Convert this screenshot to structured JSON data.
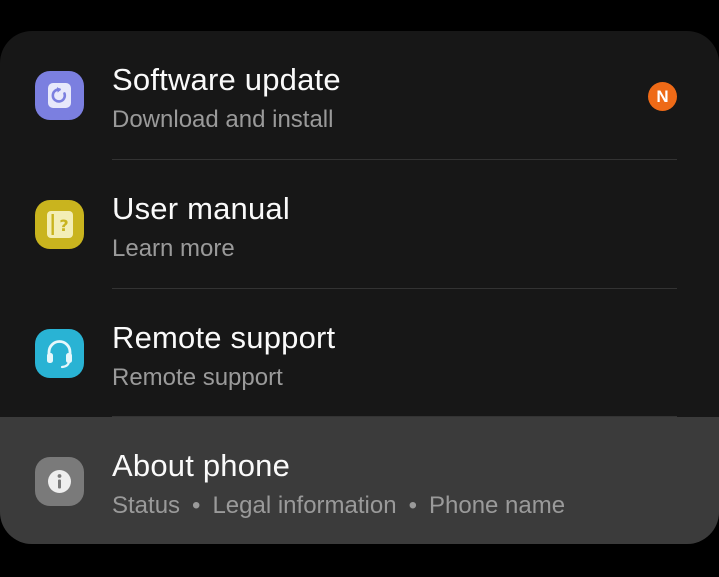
{
  "colors": {
    "card_background": "#171717",
    "selected_row_background": "#3b3b3b",
    "title_text": "#fafafa",
    "subtitle_text": "#9a9a9a",
    "software_update_icon": "#7b7fe0",
    "user_manual_icon": "#c9b41e",
    "remote_support_icon": "#29b3d4",
    "about_phone_icon": "#7a7a7a",
    "badge": "#ee6a17"
  },
  "items": [
    {
      "title": "Software update",
      "subtitle": "Download and install",
      "icon": "software-update-icon",
      "badge": "N"
    },
    {
      "title": "User manual",
      "subtitle": "Learn more",
      "icon": "user-manual-icon"
    },
    {
      "title": "Remote support",
      "subtitle": "Remote support",
      "icon": "headset-icon"
    },
    {
      "title": "About phone",
      "subtitle_parts": [
        "Status",
        "Legal information",
        "Phone name"
      ],
      "separator": "•",
      "icon": "info-icon",
      "selected": true
    }
  ]
}
